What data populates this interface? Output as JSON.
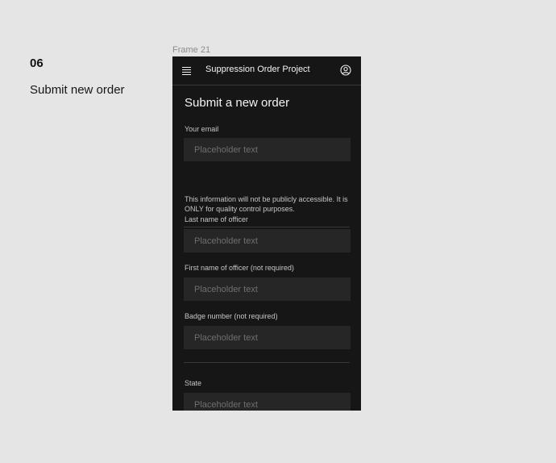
{
  "step": {
    "number": "06",
    "title": "Submit new order"
  },
  "frame": {
    "label": "Frame 21"
  },
  "header": {
    "menu_icon": "hamburger-menu-icon",
    "title": "Suppression Order Project",
    "user_icon": "user-avatar-icon"
  },
  "form": {
    "title": "Submit a new order",
    "fields": {
      "email": {
        "label": "Your email",
        "placeholder": "Placeholder text",
        "value": ""
      },
      "last_name": {
        "label": "Last name of officer",
        "placeholder": "Placeholder text",
        "value": ""
      },
      "first_name": {
        "label": "First name of officer (not required)",
        "placeholder": "Placeholder text",
        "value": ""
      },
      "badge": {
        "label": "Badge number (not required)",
        "placeholder": "Placeholder text",
        "value": ""
      },
      "state": {
        "label": "State",
        "placeholder": "Placeholder text",
        "value": ""
      }
    },
    "email_helper": "This information will not be publicly accessible. It is ONLY for quality control purposes."
  },
  "colors": {
    "frame_bg": "#161616",
    "field_bg": "#262626",
    "divider": "#393939",
    "page_bg": "#e5e5e5"
  }
}
